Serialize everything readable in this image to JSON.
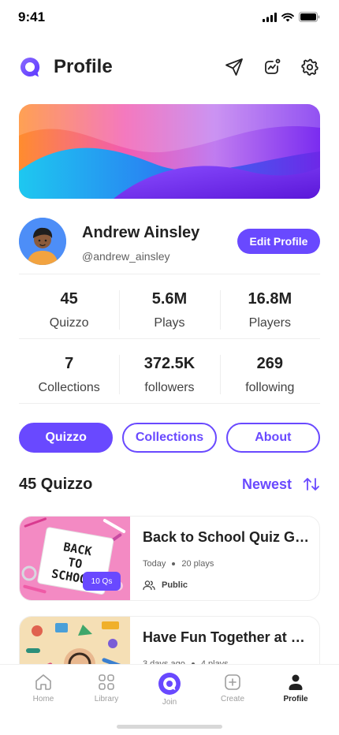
{
  "status": {
    "time": "9:41"
  },
  "header": {
    "title": "Profile"
  },
  "user": {
    "name": "Andrew Ainsley",
    "handle": "@andrew_ainsley",
    "edit_label": "Edit Profile"
  },
  "stats": [
    {
      "value": "45",
      "label": "Quizzo"
    },
    {
      "value": "5.6M",
      "label": "Plays"
    },
    {
      "value": "16.8M",
      "label": "Players"
    },
    {
      "value": "7",
      "label": "Collections"
    },
    {
      "value": "372.5K",
      "label": "followers"
    },
    {
      "value": "269",
      "label": "following"
    }
  ],
  "tabs": [
    {
      "label": "Quizzo",
      "active": true
    },
    {
      "label": "Collections",
      "active": false
    },
    {
      "label": "About",
      "active": false
    }
  ],
  "section": {
    "title": "45 Quizzo",
    "sort_label": "Newest"
  },
  "quizzes": [
    {
      "title": "Back to School Quiz Game",
      "date": "Today",
      "plays": "20 plays",
      "visibility": "Public",
      "questions": "10 Qs",
      "thumb_words": [
        "BACK",
        "TO",
        "SCHOOL"
      ]
    },
    {
      "title": "Have Fun Together at School",
      "date": "3 days ago",
      "plays": "4 plays"
    }
  ],
  "nav": [
    {
      "label": "Home",
      "icon": "home-icon",
      "active": false
    },
    {
      "label": "Library",
      "icon": "library-icon",
      "active": false
    },
    {
      "label": "Join",
      "icon": "join-icon",
      "active": false
    },
    {
      "label": "Create",
      "icon": "create-icon",
      "active": false
    },
    {
      "label": "Profile",
      "icon": "profile-icon",
      "active": true
    }
  ],
  "colors": {
    "primary": "#6949ff",
    "text": "#212121",
    "muted": "#616161",
    "divider": "#eeeeee"
  }
}
